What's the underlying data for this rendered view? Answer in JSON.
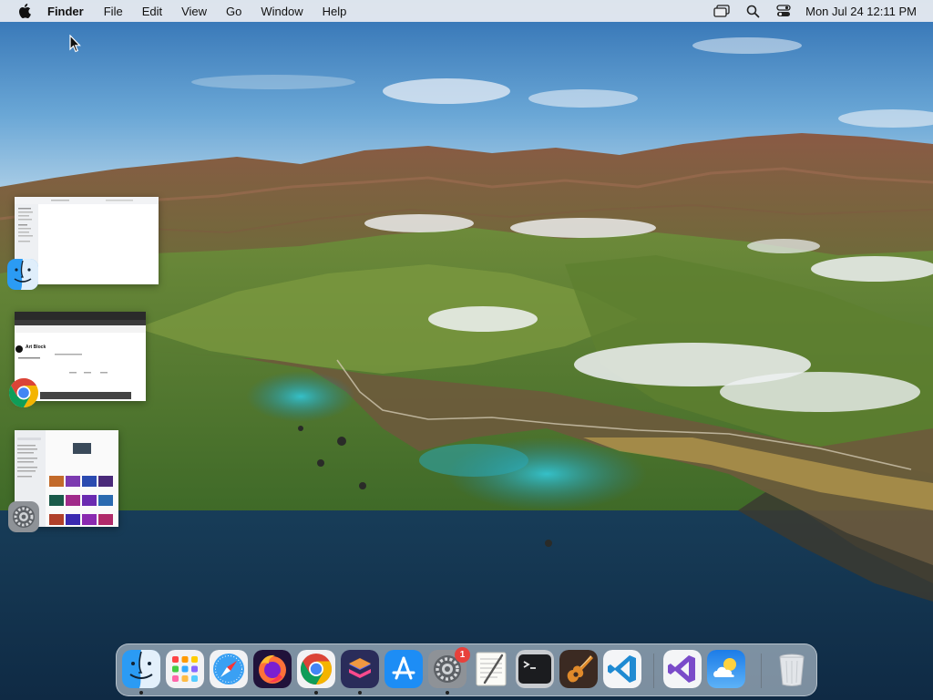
{
  "menubar": {
    "apple_icon": "apple-logo-icon",
    "app_name": "Finder",
    "items": [
      "File",
      "Edit",
      "View",
      "Go",
      "Window",
      "Help"
    ],
    "status_icons": [
      "screen-mirroring-icon",
      "search-icon",
      "control-center-icon"
    ],
    "clock": "Mon Jul 24  12:11 PM"
  },
  "window_previews": [
    {
      "app": "Finder",
      "icon": "finder-icon"
    },
    {
      "app": "Chrome",
      "icon": "chrome-icon",
      "visible_heading": "Art Block"
    },
    {
      "app": "System Settings",
      "icon": "system-settings-icon"
    }
  ],
  "dock": {
    "items": [
      {
        "name": "Finder",
        "icon": "finder-icon",
        "running": true
      },
      {
        "name": "Launchpad",
        "icon": "launchpad-icon",
        "running": false
      },
      {
        "name": "Safari",
        "icon": "safari-icon",
        "running": false
      },
      {
        "name": "Firefox",
        "icon": "firefox-icon",
        "running": false
      },
      {
        "name": "Google Chrome",
        "icon": "chrome-icon",
        "running": true
      },
      {
        "name": "Shortcuts",
        "icon": "shortcuts-icon",
        "running": true
      },
      {
        "name": "App Store",
        "icon": "app-store-icon",
        "running": false
      },
      {
        "name": "System Settings",
        "icon": "system-settings-icon",
        "running": true,
        "badge": "1"
      },
      {
        "name": "TextEdit",
        "icon": "textedit-icon",
        "running": false
      },
      {
        "name": "Terminal",
        "icon": "terminal-icon",
        "running": false
      },
      {
        "name": "GarageBand",
        "icon": "garageband-icon",
        "running": false
      },
      {
        "name": "Visual Studio Code",
        "icon": "vscode-icon",
        "running": false
      },
      {
        "name": "Visual Studio",
        "icon": "visual-studio-icon",
        "running": false
      },
      {
        "name": "Weather",
        "icon": "weather-icon",
        "running": false
      },
      {
        "name": "Trash",
        "icon": "trash-icon",
        "running": false
      }
    ]
  },
  "colors": {
    "menubar_bg": "#eceef2",
    "badge_red": "#e8413b",
    "sea": "#1d4a66",
    "sky": "#3f7fbf"
  }
}
